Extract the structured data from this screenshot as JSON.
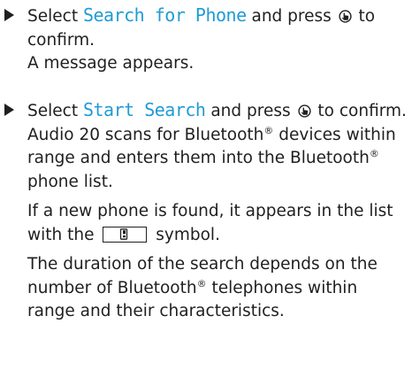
{
  "step1": {
    "prefix": "Select ",
    "menu_item": "Search for Phone",
    "middle": " and press ",
    "knob_icon": "controller-press-icon",
    "suffix": " to confirm.",
    "result": "A message appears."
  },
  "step2": {
    "prefix": "Select ",
    "menu_item": "Start Search",
    "middle": " and press ",
    "knob_icon": "controller-press-icon",
    "suffix": " to confirm.",
    "result_a": "Audio 20 scans for Bluetooth",
    "result_b": " devices within range and enters them into the Bluetooth",
    "result_c": " phone list.",
    "para2_a": "If a new phone is found, it appears in the list with the ",
    "phone_symbol_icon": "mobile-phone-icon",
    "para2_b": " symbol.",
    "para3_a": "The duration of the search depends on the number of Bluetooth",
    "para3_b": " telephones within range and their characteristics.",
    "registered_mark": "®"
  }
}
